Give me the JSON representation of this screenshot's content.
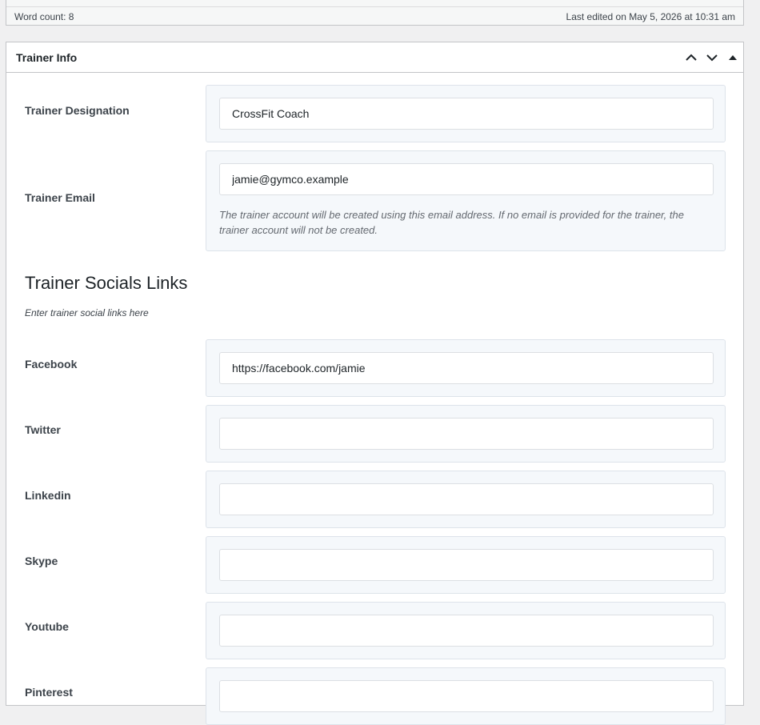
{
  "status_bar": {
    "word_count": "Word count: 8",
    "last_edited": "Last edited on May 5, 2026 at 10:31 am"
  },
  "metabox": {
    "title": "Trainer Info",
    "icons": [
      "chevron-up-icon",
      "chevron-down-icon",
      "triangle-up-icon"
    ]
  },
  "fields": {
    "designation": {
      "label": "Trainer Designation",
      "value": "CrossFit Coach"
    },
    "email": {
      "label": "Trainer Email",
      "value": "jamie@gymco.example",
      "description": "The trainer account will be created using this email address. If no email is provided for the trainer, the trainer account will not be created."
    }
  },
  "socials": {
    "heading": "Trainer Socials Links",
    "subheading": "Enter trainer social links here",
    "facebook": {
      "label": "Facebook",
      "value": "https://facebook.com/jamie"
    },
    "twitter": {
      "label": "Twitter",
      "value": ""
    },
    "linkedin": {
      "label": "Linkedin",
      "value": ""
    },
    "skype": {
      "label": "Skype",
      "value": ""
    },
    "youtube": {
      "label": "Youtube",
      "value": ""
    },
    "pinterest": {
      "label": "Pinterest",
      "value": ""
    }
  }
}
